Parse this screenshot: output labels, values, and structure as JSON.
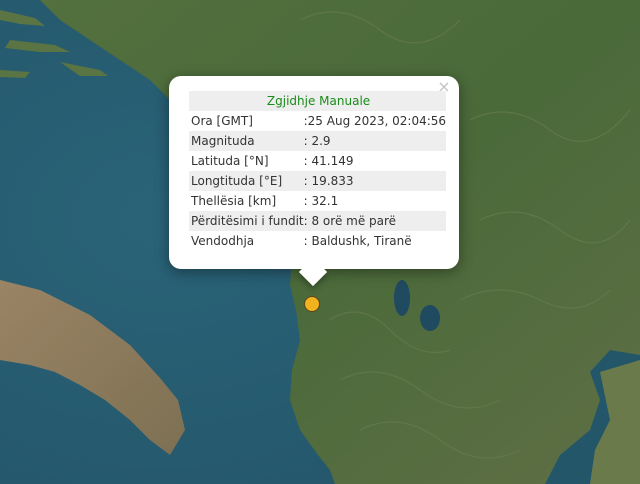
{
  "popup": {
    "title": "Zgjidhje Manuale",
    "close_symbol": "×",
    "rows": [
      {
        "label": "Ora [GMT]",
        "value": ":25 Aug 2023, 02:04:56"
      },
      {
        "label": "Magnituda",
        "value": ": 2.9"
      },
      {
        "label": "Latituda [°N]",
        "value": ": 41.149"
      },
      {
        "label": "Longtituda [°E]",
        "value": ": 19.833"
      },
      {
        "label": "Thellësia [km]",
        "value": ": 32.1"
      },
      {
        "label": "Përditësimi i fundit",
        "value": ": 8 orë më parë"
      },
      {
        "label": "Vendodhja",
        "value": ": Baldushk, Tiranë"
      }
    ]
  },
  "marker": {
    "color": "#f0b21e",
    "icon": "earthquake-marker-icon"
  },
  "colors": {
    "sea": "#2b5f72",
    "land": "#4d6b3c",
    "title": "#1a8c1a"
  }
}
